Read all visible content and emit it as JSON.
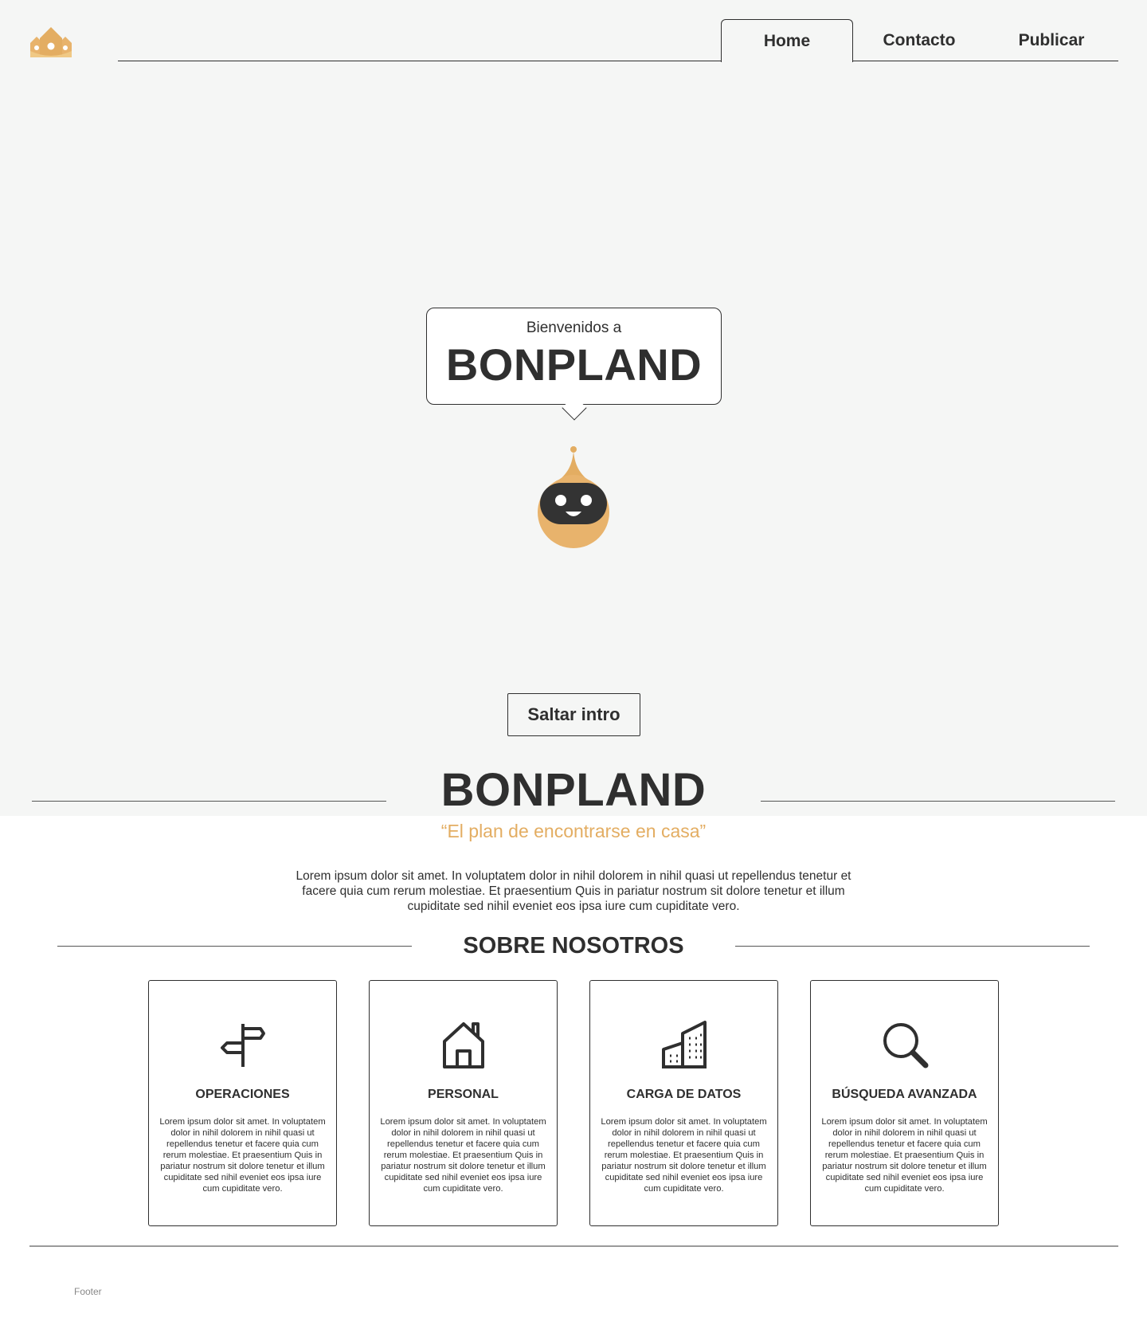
{
  "nav": {
    "items": [
      {
        "label": "Home",
        "active": true
      },
      {
        "label": "Contacto",
        "active": false
      },
      {
        "label": "Publicar",
        "active": false
      }
    ]
  },
  "hero": {
    "welcome": "Bienvenidos a",
    "title": "BONPLAND",
    "skip_label": "Saltar intro"
  },
  "brand": {
    "title": "BONPLAND",
    "tagline": "“El plan de encontrarse en casa”",
    "intro": "Lorem ipsum dolor sit amet. In voluptatem dolor in nihil dolorem in nihil quasi ut repellendus tenetur et facere quia cum rerum molestiae. Et praesentium Quis in pariatur nostrum sit dolore tenetur et illum cupiditate sed nihil eveniet eos ipsa iure cum cupiditate vero."
  },
  "about": {
    "title": "SOBRE NOSOTROS",
    "cards": [
      {
        "icon": "signpost-icon",
        "title": "OPERACIONES",
        "text": "Lorem ipsum dolor sit amet. In voluptatem dolor in nihil dolorem in nihil quasi ut repellendus tenetur et facere quia cum rerum molestiae. Et praesentium Quis in pariatur nostrum sit dolore tenetur et illum cupiditate sed nihil eveniet eos ipsa iure cum cupiditate vero."
      },
      {
        "icon": "house-icon",
        "title": "PERSONAL",
        "text": "Lorem ipsum dolor sit amet. In voluptatem dolor in nihil dolorem in nihil quasi ut repellendus tenetur et facere quia cum rerum molestiae. Et praesentium Quis in pariatur nostrum sit dolore tenetur et illum cupiditate sed nihil eveniet eos ipsa iure cum cupiditate vero."
      },
      {
        "icon": "buildings-icon",
        "title": "CARGA DE DATOS",
        "text": "Lorem ipsum dolor sit amet. In voluptatem dolor in nihil dolorem in nihil quasi ut repellendus tenetur et facere quia cum rerum molestiae. Et praesentium Quis in pariatur nostrum sit dolore tenetur et illum cupiditate sed nihil eveniet eos ipsa iure cum cupiditate vero."
      },
      {
        "icon": "magnifier-icon",
        "title": "BÚSQUEDA AVANZADA",
        "text": "Lorem ipsum dolor sit amet. In voluptatem dolor in nihil dolorem in nihil quasi ut repellendus tenetur et facere quia cum rerum molestiae. Et praesentium Quis in pariatur nostrum sit dolore tenetur et illum cupiditate sed nihil eveniet eos ipsa iure cum cupiditate vero."
      }
    ]
  },
  "footer": {
    "label": "Footer"
  },
  "colors": {
    "accent": "#e3ad62",
    "text": "#2f2f2f",
    "hero_bg": "#f5f6f5"
  },
  "icons": {
    "logo": "houses-logo-icon",
    "mascot": "robot-mascot-icon"
  }
}
